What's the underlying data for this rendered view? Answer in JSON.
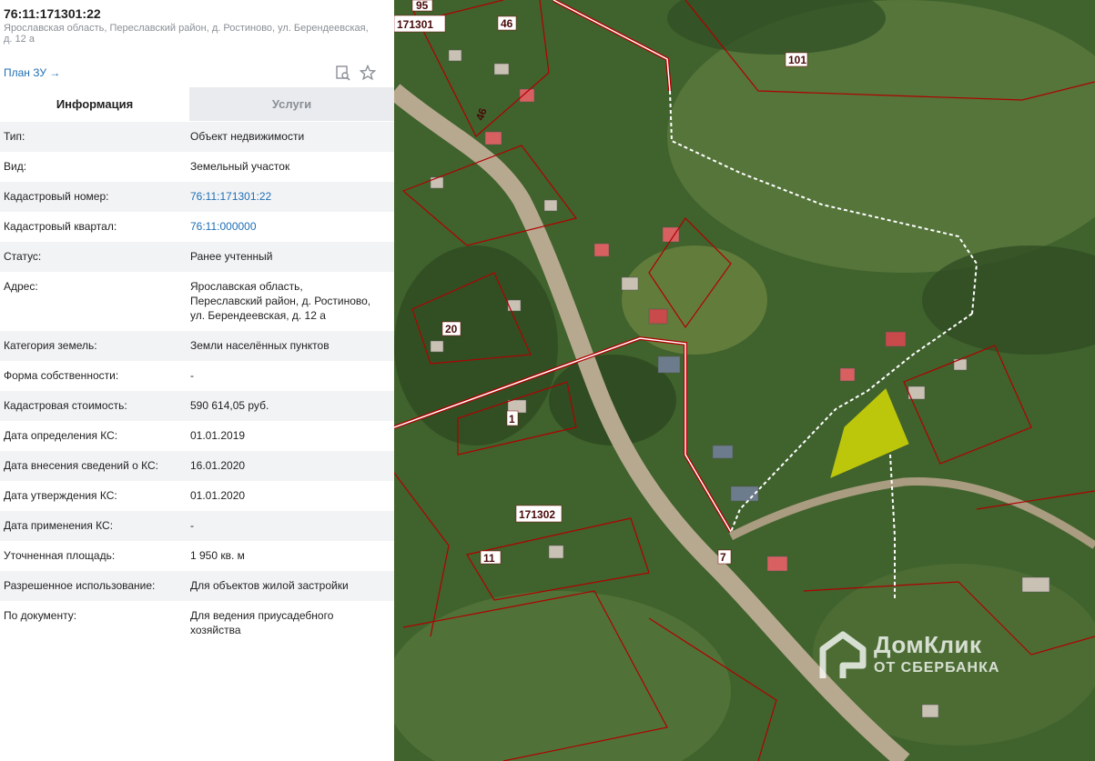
{
  "header": {
    "cadastral_title": "76:11:171301:22",
    "address": "Ярославская область, Переславский район, д. Ростиново, ул. Берендеевская, д. 12 а",
    "plan_link": "План ЗУ →"
  },
  "toolbar": {
    "zoom_icon": "search-doc-icon",
    "favorite_icon": "star-icon"
  },
  "tabs": [
    {
      "label": "Информация",
      "active": true
    },
    {
      "label": "Услуги",
      "active": false
    }
  ],
  "info": [
    {
      "label": "Тип:",
      "value": "Объект недвижимости"
    },
    {
      "label": "Вид:",
      "value": "Земельный участок"
    },
    {
      "label": "Кадастровый номер:",
      "value": "76:11:171301:22",
      "link": true
    },
    {
      "label": "Кадастровый квартал:",
      "value": "76:11:000000",
      "link": true
    },
    {
      "label": "Статус:",
      "value": "Ранее учтенный"
    },
    {
      "label": "Адрес:",
      "value": "Ярославская область, Переславский район, д. Ростиново, ул. Берендеевская, д. 12 а"
    },
    {
      "label": "Категория земель:",
      "value": "Земли населённых пунктов"
    },
    {
      "label": "Форма собственности:",
      "value": "-"
    },
    {
      "label": "Кадастровая стоимость:",
      "value": "590 614,05 руб."
    },
    {
      "label": "Дата определения КС:",
      "value": "01.01.2019"
    },
    {
      "label": "Дата внесения сведений о КС:",
      "value": "16.01.2020"
    },
    {
      "label": "Дата утверждения КС:",
      "value": "01.01.2020"
    },
    {
      "label": "Дата применения КС:",
      "value": "-"
    },
    {
      "label": "Уточненная площадь:",
      "value": "1 950 кв. м"
    },
    {
      "label": "Разрешенное использование:",
      "value": "Для объектов жилой застройки"
    },
    {
      "label": "По документу:",
      "value": "Для ведения приусадебного хозяйства"
    }
  ],
  "map": {
    "labels": {
      "q171301": "171301",
      "q171302": "171302",
      "p95": "95",
      "p46a": "46",
      "p46b": "46",
      "p101": "101",
      "p20": "20",
      "p1": "1",
      "p11": "11",
      "p7": "7"
    },
    "colors": {
      "parcel_border": "#b00000",
      "highlight": "#e6e800",
      "road": "#b7a98f"
    }
  },
  "watermark": {
    "line1": "ДомКлик",
    "line2": "ОТ СБЕРБАНКА"
  }
}
